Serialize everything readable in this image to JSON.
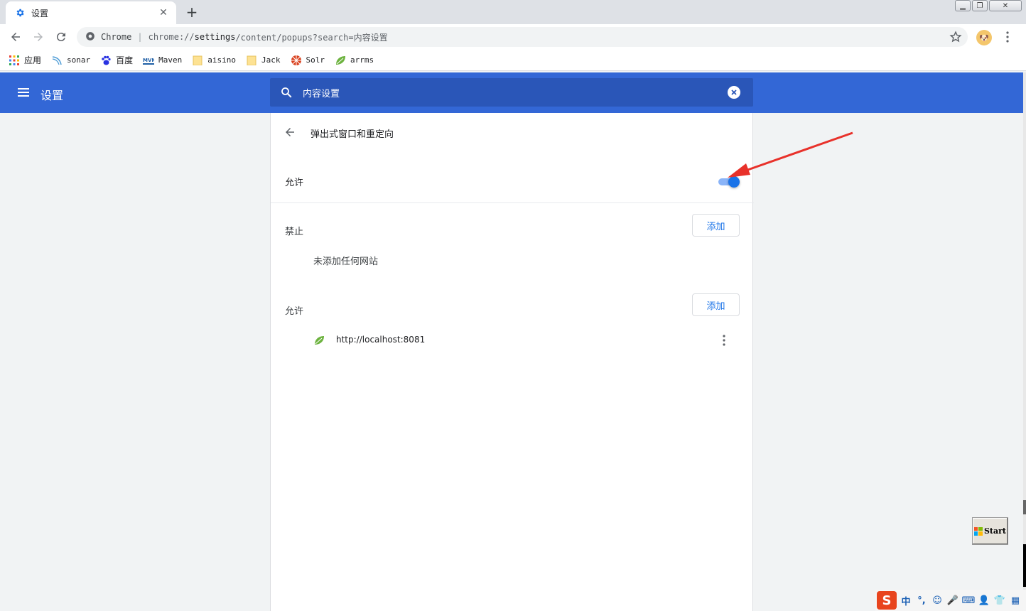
{
  "browser": {
    "tab": {
      "title": "设置",
      "favicon": "gear-icon",
      "close_glyph": "✕"
    },
    "newtab_glyph": "+",
    "window_controls": [
      "minimize",
      "restore",
      "close"
    ],
    "omnibox": {
      "site_label": "Chrome",
      "url_scheme": "chrome://",
      "url_host": "settings",
      "url_rest": "/content/popups?search=内容设置"
    },
    "profile_glyph": "🐶",
    "bookmarks": [
      {
        "label": "应用",
        "icon": "apps-grid-icon"
      },
      {
        "label": "sonar",
        "icon": "sonar-icon"
      },
      {
        "label": "百度",
        "icon": "baidu-paw-icon"
      },
      {
        "label": "Maven",
        "icon": "maven-icon"
      },
      {
        "label": "aisino",
        "icon": "folder-icon"
      },
      {
        "label": "Jack",
        "icon": "folder-icon"
      },
      {
        "label": "Solr",
        "icon": "solr-icon"
      },
      {
        "label": "arrms",
        "icon": "spring-leaf-icon"
      }
    ]
  },
  "settings": {
    "header_title": "设置",
    "search": {
      "value": "内容设置"
    },
    "page": {
      "title": "弹出式窗口和重定向",
      "main_toggle": {
        "label": "允许",
        "enabled": true
      },
      "block_section": {
        "label": "禁止",
        "add_label": "添加",
        "empty_text": "未添加任何网站"
      },
      "allow_section": {
        "label": "允许",
        "add_label": "添加",
        "sites": [
          {
            "url": "http://localhost:8081",
            "icon": "spring-leaf-icon"
          }
        ]
      }
    }
  },
  "overlay": {
    "start_label": "Start",
    "ime": {
      "logo": "S",
      "items": [
        "中",
        "°,",
        "☺",
        "🎤",
        "⌨",
        "👤",
        "👕",
        "▦"
      ]
    }
  },
  "colors": {
    "header_blue": "#3367d6",
    "search_blue": "#2a56b8",
    "accent": "#1a73e8",
    "arrow_red": "#e8312a"
  }
}
